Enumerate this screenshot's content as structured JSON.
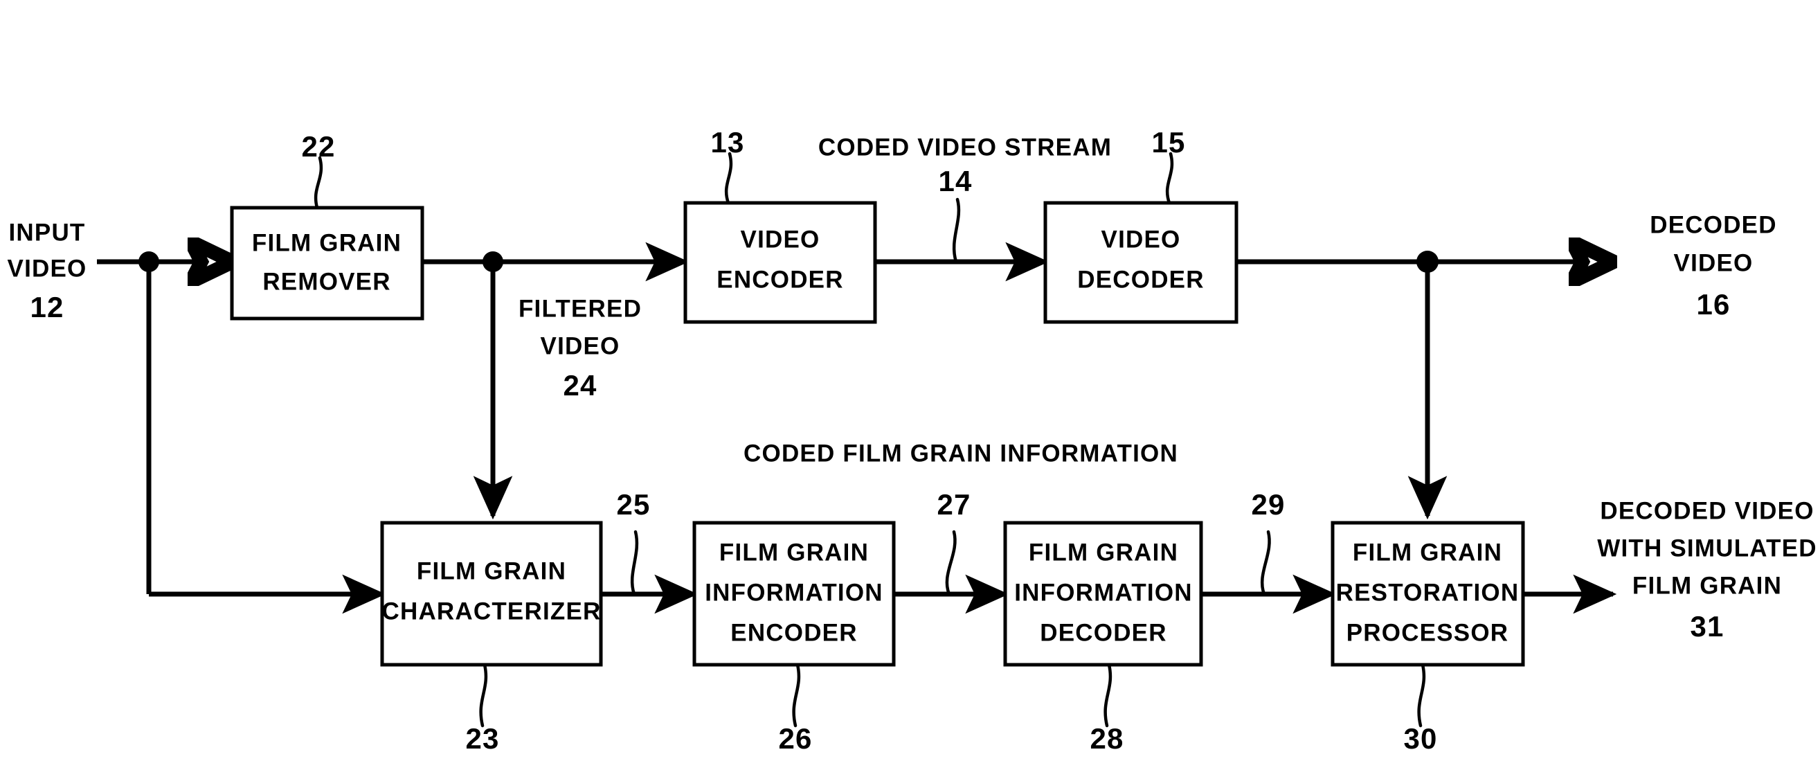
{
  "figure": {
    "title": "Film grain removal, coding and restoration block diagram",
    "ink_color": "#000000",
    "background_color": "#ffffff"
  },
  "blocks": {
    "film_grain_remover": {
      "line1": "FILM GRAIN",
      "line2": "REMOVER",
      "ref": "22"
    },
    "video_encoder": {
      "line1": "VIDEO",
      "line2": "ENCODER",
      "ref": "13"
    },
    "video_decoder": {
      "line1": "VIDEO",
      "line2": "DECODER",
      "ref": "15"
    },
    "film_grain_characterizer": {
      "line1": "FILM GRAIN",
      "line2": "CHARACTERIZER",
      "ref": "23"
    },
    "film_grain_information_encoder": {
      "line1": "FILM GRAIN",
      "line2": "INFORMATION",
      "line3": "ENCODER",
      "ref": "26"
    },
    "film_grain_information_decoder": {
      "line1": "FILM GRAIN",
      "line2": "INFORMATION",
      "line3": "DECODER",
      "ref": "28"
    },
    "film_grain_restoration_processor": {
      "line1": "FILM GRAIN",
      "line2": "RESTORATION",
      "line3": "PROCESSOR",
      "ref": "30"
    }
  },
  "signals": {
    "input_video": {
      "line1": "INPUT",
      "line2": "VIDEO",
      "ref": "12"
    },
    "filtered_video": {
      "line1": "FILTERED",
      "line2": "VIDEO",
      "ref": "24"
    },
    "coded_video_stream": {
      "label": "CODED  VIDEO  STREAM",
      "ref": "14"
    },
    "decoded_video": {
      "line1": "DECODED",
      "line2": "VIDEO",
      "ref": "16"
    },
    "coded_film_grain_information": {
      "label": "CODED  FILM  GRAIN  INFORMATION",
      "ref": "27"
    },
    "film_grain_info_out": {
      "ref": "25"
    },
    "decoded_film_grain_info": {
      "ref": "29"
    },
    "decoded_video_with_simulated_film_grain": {
      "line1": "DECODED VIDEO",
      "line2": "WITH SIMULATED",
      "line3": "FILM GRAIN",
      "ref": "31"
    }
  }
}
